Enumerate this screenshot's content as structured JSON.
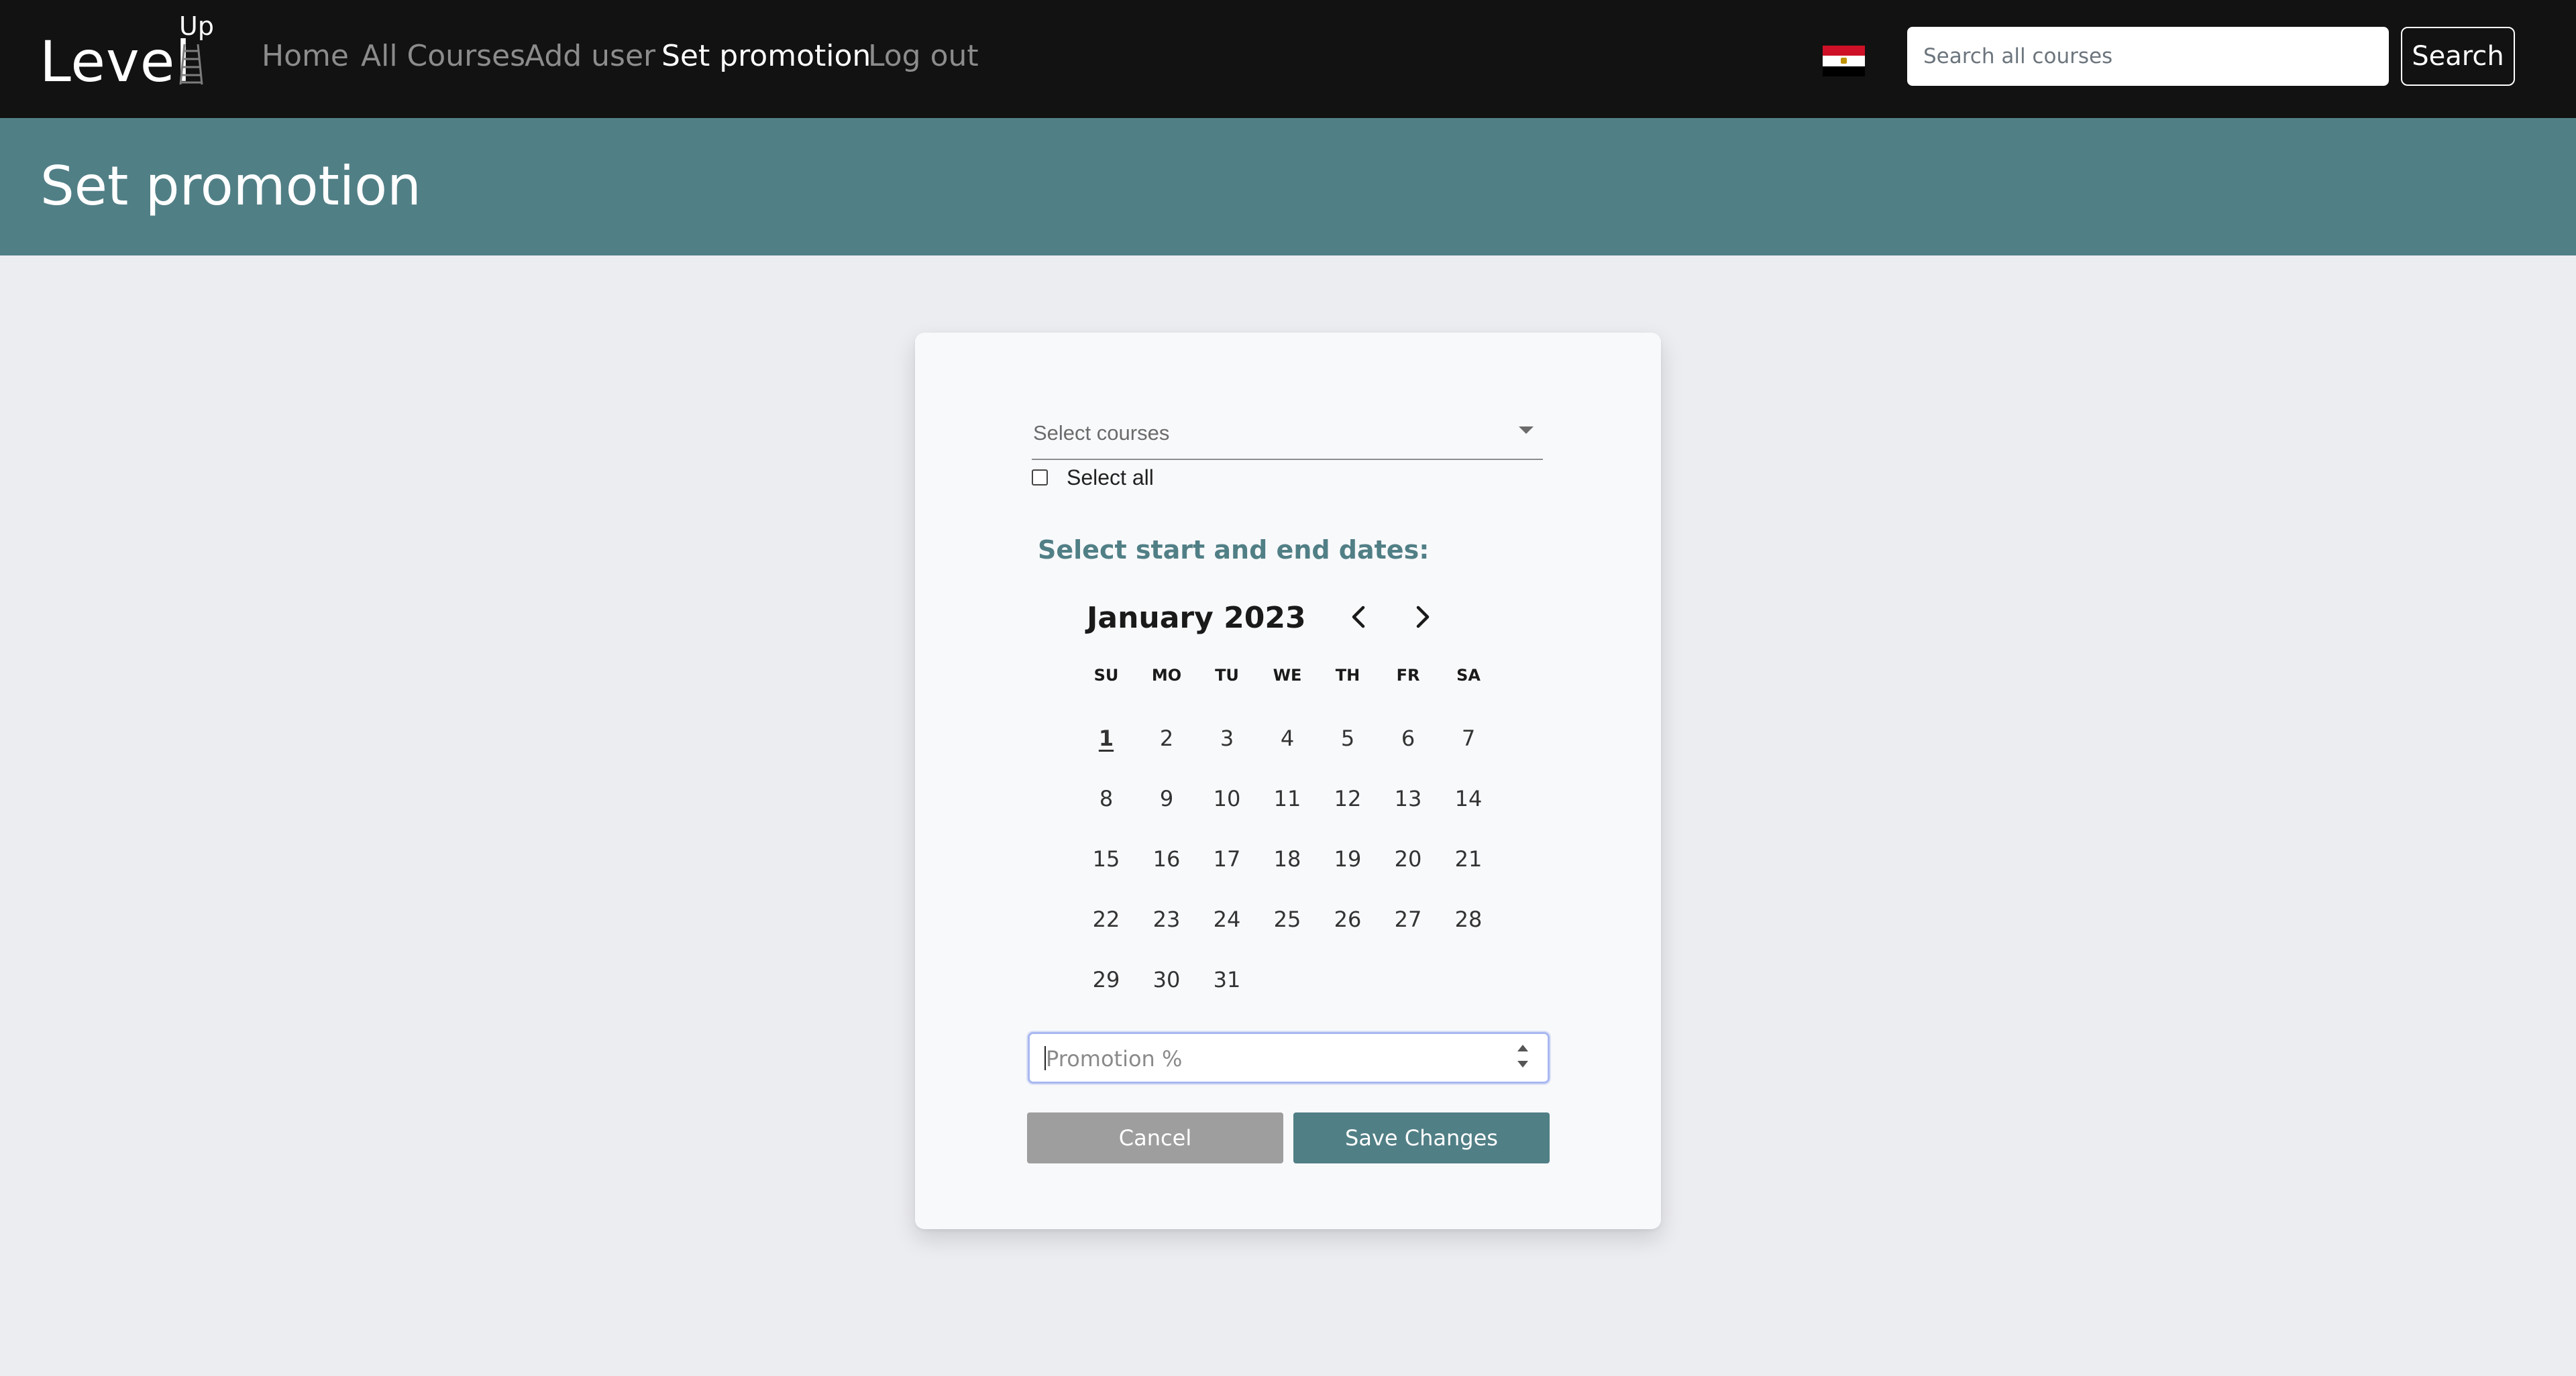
{
  "brand": {
    "name": "Level",
    "superscript": "Up"
  },
  "nav": {
    "links": [
      {
        "label": "Home",
        "active": false
      },
      {
        "label": "All Courses",
        "active": false
      },
      {
        "label": "Add user",
        "active": false
      },
      {
        "label": "Set promotion",
        "active": true
      },
      {
        "label": "Log out",
        "active": false
      }
    ],
    "language_flag": "egypt-flag-icon",
    "search": {
      "placeholder": "Search all courses",
      "value": "",
      "button_label": "Search"
    }
  },
  "header": {
    "title": "Set promotion"
  },
  "form": {
    "course_select": {
      "placeholder": "Select courses",
      "selected": ""
    },
    "select_all": {
      "label": "Select all",
      "checked": false
    },
    "dates_heading": "Select start and end dates:",
    "calendar": {
      "month_label": "January 2023",
      "weekdays": [
        "SU",
        "MO",
        "TU",
        "WE",
        "TH",
        "FR",
        "SA"
      ],
      "first_weekday_index": 0,
      "days_in_month": 31,
      "today": 1
    },
    "promotion": {
      "placeholder": "Promotion %",
      "value": ""
    },
    "cancel_label": "Cancel",
    "save_label": "Save Changes"
  },
  "colors": {
    "navbar": "#121212",
    "accent": "#517f86",
    "page_bg": "#ecedf1",
    "cancel": "#9e9e9e"
  }
}
